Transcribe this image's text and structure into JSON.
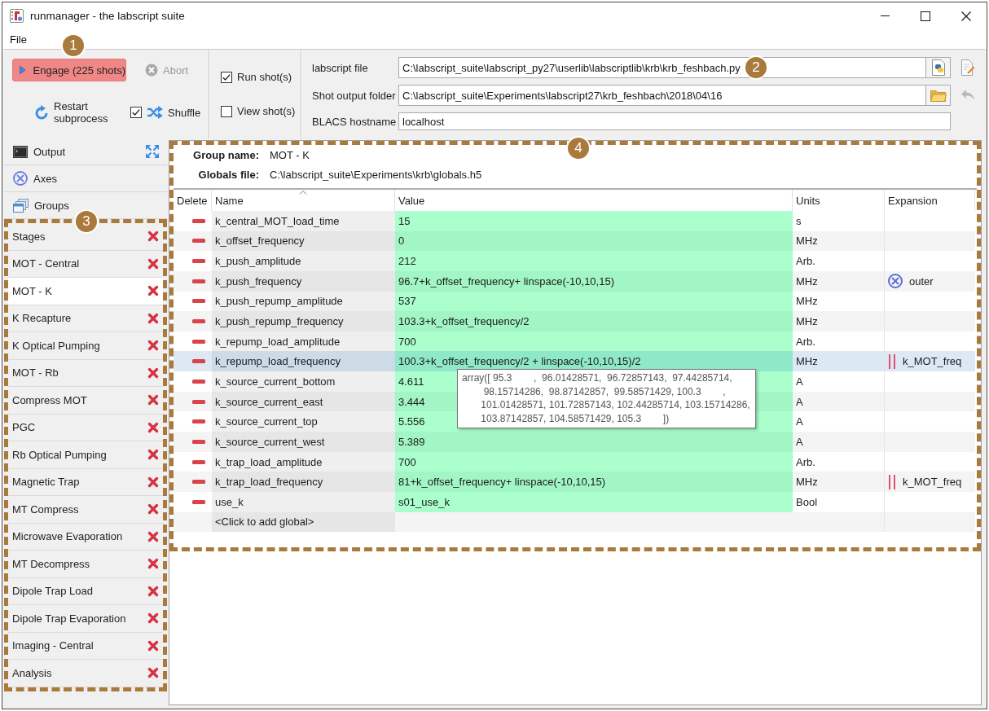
{
  "window": {
    "title": "runmanager - the labscript suite"
  },
  "menu": [
    {
      "label": "File"
    }
  ],
  "toolbar": {
    "callout": {
      "number": "1"
    },
    "engage": {
      "label": "Engage (225 shots)"
    },
    "abort": {
      "label": "Abort",
      "disabled": true
    },
    "restart": {
      "label": "Restart subprocess"
    },
    "shuffle": {
      "label": "Shuffle",
      "checked": true
    },
    "run_shots": {
      "label": "Run shot(s)",
      "checked": true
    },
    "view_shots": {
      "label": "View shot(s)",
      "checked": false
    }
  },
  "paths": {
    "callout": {
      "number": "2"
    },
    "fields": [
      {
        "label": "labscript file",
        "value": "C:\\labscript_suite\\labscript_py27\\userlib\\labscriptlib\\krb\\krb_feshbach.py",
        "kind": "script"
      },
      {
        "label": "Shot output folder",
        "value": "C:\\labscript_suite\\Experiments\\labscript27\\krb_feshbach\\2018\\04\\16",
        "kind": "folder"
      },
      {
        "label": "BLACS hostname",
        "value": "localhost",
        "kind": "text"
      }
    ]
  },
  "sidebar": {
    "panels": [
      {
        "label": "Output",
        "kind": "output"
      },
      {
        "label": "Axes",
        "kind": "axes"
      },
      {
        "label": "Groups",
        "kind": "groups"
      }
    ],
    "callout": {
      "number": "3",
      "framed": true
    },
    "groups": [
      {
        "label": "Stages",
        "selected": false
      },
      {
        "label": "MOT - Central",
        "selected": false
      },
      {
        "label": "MOT - K",
        "selected": true
      },
      {
        "label": "K Recapture",
        "selected": false
      },
      {
        "label": "K Optical Pumping",
        "selected": false
      },
      {
        "label": "MOT - Rb",
        "selected": false
      },
      {
        "label": "Compress MOT",
        "selected": false
      },
      {
        "label": "PGC",
        "selected": false
      },
      {
        "label": "Rb Optical Pumping",
        "selected": false
      },
      {
        "label": "Magnetic Trap",
        "selected": false
      },
      {
        "label": "MT Compress",
        "selected": false
      },
      {
        "label": "Microwave Evaporation",
        "selected": false
      },
      {
        "label": "MT Decompress",
        "selected": false
      },
      {
        "label": "Dipole Trap Load",
        "selected": false
      },
      {
        "label": "Dipole Trap Evaporation",
        "selected": false
      },
      {
        "label": "Imaging - Central",
        "selected": false
      },
      {
        "label": "Analysis",
        "selected": false
      }
    ]
  },
  "group_panel": {
    "callout": {
      "number": "4",
      "framed": true
    },
    "info": [
      {
        "label": "Group name:",
        "value": "MOT - K"
      },
      {
        "label": "Globals file:",
        "value": "C:\\labscript_suite\\Experiments\\krb\\globals.h5"
      }
    ],
    "table": {
      "columns": [
        {
          "label": "Delete",
          "sorted": false
        },
        {
          "label": "Name",
          "sorted": true
        },
        {
          "label": "Value",
          "sorted": false
        },
        {
          "label": "Units",
          "sorted": false
        },
        {
          "label": "Expansion",
          "sorted": false
        }
      ],
      "rows": [
        {
          "name": "k_central_MOT_load_time",
          "value": "15",
          "units": "s",
          "selected": false
        },
        {
          "name": "k_offset_frequency",
          "value": "0",
          "units": "MHz",
          "selected": false
        },
        {
          "name": "k_push_amplitude",
          "value": "212",
          "units": "Arb.",
          "selected": false
        },
        {
          "name": "k_push_frequency",
          "value": "96.7+k_offset_frequency+ linspace(-10,10,15)",
          "units": "MHz",
          "selected": false,
          "expansion": {
            "text": "outer",
            "kind": "outer"
          }
        },
        {
          "name": "k_push_repump_amplitude",
          "value": "537",
          "units": "MHz",
          "selected": false
        },
        {
          "name": "k_push_repump_frequency",
          "value": "103.3+k_offset_frequency/2",
          "units": "MHz",
          "selected": false
        },
        {
          "name": "k_repump_load_amplitude",
          "value": "700",
          "units": "Arb.",
          "selected": false
        },
        {
          "name": "k_repump_load_frequency",
          "value": "100.3+k_offset_frequency/2 + linspace(-10,10,15)/2",
          "units": "MHz",
          "selected": true,
          "expansion": {
            "text": "k_MOT_freq",
            "kind": "zip"
          }
        },
        {
          "name": "k_source_current_bottom",
          "value": "4.611",
          "units": "A",
          "selected": false
        },
        {
          "name": "k_source_current_east",
          "value": "3.444",
          "units": "A",
          "selected": false
        },
        {
          "name": "k_source_current_top",
          "value": "5.556",
          "units": "A",
          "selected": false
        },
        {
          "name": "k_source_current_west",
          "value": "5.389",
          "units": "A",
          "selected": false
        },
        {
          "name": "k_trap_load_amplitude",
          "value": "700",
          "units": "Arb.",
          "selected": false
        },
        {
          "name": "k_trap_load_frequency",
          "value": "81+k_offset_frequency+ linspace(-10,10,15)",
          "units": "MHz",
          "selected": false,
          "expansion": {
            "text": "k_MOT_freq",
            "kind": "zip"
          }
        },
        {
          "name": "use_k",
          "value": "s01_use_k",
          "units": "Bool",
          "selected": false
        }
      ],
      "add_row": "<Click to add global>"
    },
    "tooltip": {
      "lines": [
        "array([ 95.3        ,  96.01428571,  96.72857143,  97.44285714,",
        "        98.15714286,  98.87142857,  99.58571429, 100.3        ,",
        "       101.01428571, 101.72857143, 102.44285714, 103.15714286,",
        "       103.87142857, 104.58571429, 105.3        ])"
      ]
    }
  }
}
